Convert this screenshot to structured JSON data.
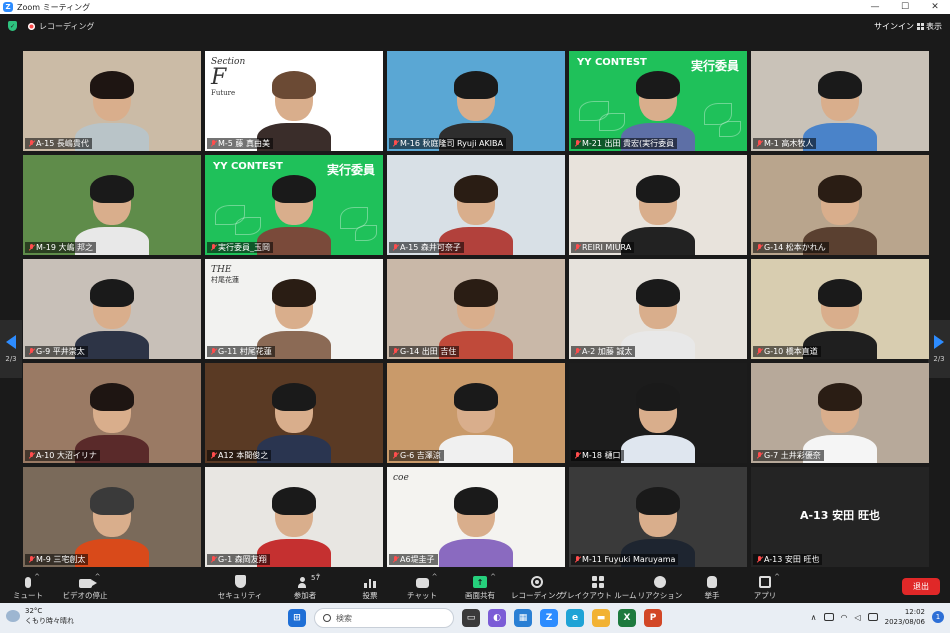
{
  "window": {
    "title": "Zoom ミーティング",
    "controls": [
      "—",
      "☐",
      "✕"
    ]
  },
  "topbar": {
    "recording_label": "レコーディング",
    "signin": "サインイン",
    "view_label": "表示"
  },
  "pager": {
    "left_page": "2/3",
    "right_page": "2/3"
  },
  "participants": [
    {
      "name": "A-15 長嶋貴代",
      "bg": "#cbbba6",
      "shirt": "#b9c4c8",
      "hair": "#1e1512"
    },
    {
      "name": "M-5 藤 真由美",
      "bg": "#ffffff",
      "shirt": "#3a2d2a",
      "hair": "#6b4a34",
      "logo_text": "Section",
      "logo_letter": "F",
      "logo_sub": "Future"
    },
    {
      "name": "M-16 秋庭隆司 Ryuji AKIBA",
      "bg": "#5aa7d4",
      "shirt": "#2e2e2e",
      "hair": "#1a1a1a"
    },
    {
      "name": "M-21 出田 貴宏(実行委員",
      "bg": "#1fc15a",
      "shirt": "#5d6fa6",
      "hair": "#1a1a1a",
      "banner_left": "YY CONTEST",
      "banner_right": "実行委員"
    },
    {
      "name": "M-1 高木牧人",
      "bg": "#c9c2b8",
      "shirt": "#4a83c9",
      "hair": "#1a1a1a"
    },
    {
      "name": "M-19 大嶋 邦之",
      "bg": "#5f8c4a",
      "shirt": "#e8e8e8",
      "hair": "#1a1a1a"
    },
    {
      "name": "実行委員_玉岡",
      "bg": "#1fc15a",
      "shirt": "#7a4a3a",
      "hair": "#1a1a1a",
      "banner_left": "YY CONTEST",
      "banner_right": "実行委員"
    },
    {
      "name": "A-15 森井可奈子",
      "bg": "#d8e0e6",
      "shirt": "#b2413c",
      "hair": "#2a1d14"
    },
    {
      "name": "REIRI MIURA",
      "bg": "#e8e3dc",
      "shirt": "#222222",
      "hair": "#1a1a1a"
    },
    {
      "name": "G-14 松本かれん",
      "bg": "#b9a58d",
      "shirt": "#5a4030",
      "hair": "#2a1d14"
    },
    {
      "name": "G-9 平井崇太",
      "bg": "#c8c0b8",
      "shirt": "#2d3446",
      "hair": "#1a1a1a"
    },
    {
      "name": "G-11 村尾花蓮",
      "bg": "#f2f2f0",
      "shirt": "#8b6a55",
      "hair": "#2a1d14",
      "logo_text": "THE",
      "logo_sub": "村尾花蓮"
    },
    {
      "name": "G-14 出田 吉住",
      "bg": "#c9b8a8",
      "shirt": "#c04a3a",
      "hair": "#2a1d14"
    },
    {
      "name": "A-2 加藤 誠太",
      "bg": "#e6e2dc",
      "shirt": "#e8e8e8",
      "hair": "#1a1a1a"
    },
    {
      "name": "G-10 橋本直道",
      "bg": "#d8cdb0",
      "shirt": "#1f1f1f",
      "hair": "#1a1a1a"
    },
    {
      "name": "A-10 大沼イリナ",
      "bg": "#9a7a64",
      "shirt": "#5a2a2a",
      "hair": "#1e1512"
    },
    {
      "name": "A12 本間俊之",
      "bg": "#5a3a24",
      "shirt": "#2a3550",
      "hair": "#1a1a1a"
    },
    {
      "name": "G-6 吉澤涼",
      "bg": "#c99a6a",
      "shirt": "#f0f0f0",
      "hair": "#1a1a1a"
    },
    {
      "name": "M-18 樋口",
      "bg": "#1c1c1c",
      "shirt": "#dfe6ef",
      "hair": "#1a1a1a"
    },
    {
      "name": "G-7 土井彩優奈",
      "bg": "#b7a99a",
      "shirt": "#f5f5f5",
      "hair": "#2a1d14"
    },
    {
      "name": "M-9 三宅創太",
      "bg": "#7a6a5a",
      "shirt": "#d94a1a",
      "hair": "#3a3a3a"
    },
    {
      "name": "G-1 森岡友翔",
      "bg": "#e8e6e2",
      "shirt": "#c53030",
      "hair": "#1a1a1a"
    },
    {
      "name": "A6堤圭子",
      "bg": "#f4f3f0",
      "shirt": "#8a6ac0",
      "hair": "#1a1a1a",
      "logo_text": "coe"
    },
    {
      "name": "M-11 Fuyuki Maruyama",
      "bg": "#3a3a3a",
      "shirt": "#1e2530",
      "hair": "#1a1a1a"
    },
    {
      "name": "A-13 安田 旺也",
      "avatar_only": true,
      "display_name": "A-13 安田 旺也"
    }
  ],
  "toolbar": [
    {
      "label": "ミュート",
      "icon": "microphone-icon"
    },
    {
      "label": "ビデオの停止",
      "icon": "video-camera-icon"
    },
    {
      "label": "セキュリティ",
      "icon": "shield-icon"
    },
    {
      "label": "参加者",
      "icon": "participants-icon",
      "count": "57"
    },
    {
      "label": "投票",
      "icon": "poll-icon"
    },
    {
      "label": "チャット",
      "icon": "chat-icon"
    },
    {
      "label": "画面共有",
      "icon": "share-screen-icon"
    },
    {
      "label": "レコーディング",
      "icon": "record-icon"
    },
    {
      "label": "ブレイクアウト ルーム",
      "icon": "breakout-rooms-icon"
    },
    {
      "label": "リアクション",
      "icon": "reaction-icon"
    },
    {
      "label": "挙手",
      "icon": "raise-hand-icon"
    },
    {
      "label": "アプリ",
      "icon": "apps-icon"
    }
  ],
  "leave_label": "退出",
  "taskbar": {
    "weather_temp": "32°C",
    "weather_desc": "くもり時々晴れ",
    "search_placeholder": "検索",
    "time": "12:02",
    "date": "2023/08/06",
    "notifications": "1"
  },
  "colors": {
    "accent": "#2d8cff",
    "green": "#1fc15a",
    "leave": "#e02828"
  }
}
